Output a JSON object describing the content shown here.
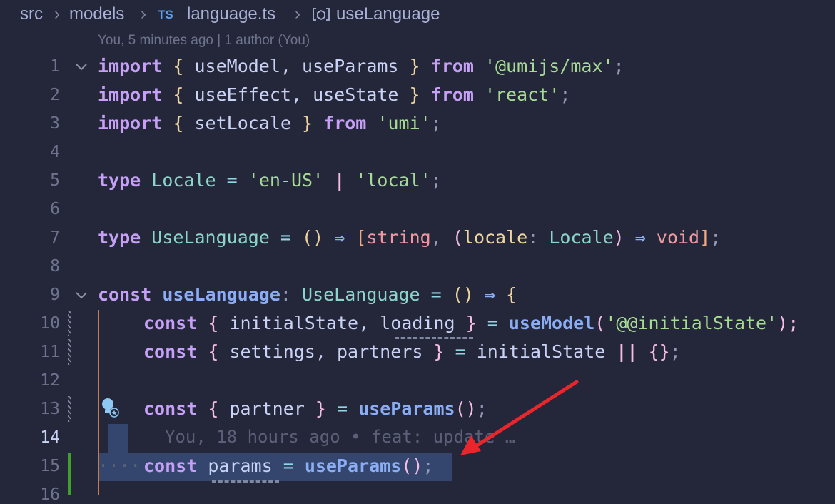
{
  "breadcrumb": {
    "items": [
      "src",
      "models",
      "language.ts",
      "useLanguage"
    ],
    "file_badge": "TS"
  },
  "blame_header": "You, 5 minutes ago | 1 author (You)",
  "inline_blame": "You, 18 hours ago • feat: update …",
  "line_numbers": [
    "1",
    "2",
    "3",
    "4",
    "5",
    "6",
    "7",
    "8",
    "9",
    "10",
    "11",
    "12",
    "13",
    "14",
    "15",
    "16"
  ],
  "active_line": "14",
  "code": {
    "l1": [
      "import",
      "{",
      "useModel, useParams",
      "}",
      "from",
      "'@umijs/max'",
      ";"
    ],
    "l2": [
      "import",
      "{",
      "useEffect, useState",
      "}",
      "from",
      "'react'",
      ";"
    ],
    "l3": [
      "import",
      "{",
      "setLocale",
      "}",
      "from",
      "'umi'",
      ";"
    ],
    "l5": [
      "type",
      "Locale",
      "=",
      "'en-US'",
      "|",
      "'local'",
      ";"
    ],
    "l7": [
      "type",
      "UseLanguage",
      "=",
      "(",
      ")",
      "⇒",
      "[",
      "string",
      ", ",
      "(",
      "locale",
      ":",
      "Locale",
      ")",
      "⇒",
      "void",
      "]",
      ";"
    ],
    "l9": [
      "const",
      "useLanguage",
      ":",
      "UseLanguage",
      "=",
      "(",
      ")",
      "⇒",
      "{"
    ],
    "l10": [
      "const",
      "{",
      "initialState, ",
      "loading",
      "}",
      "=",
      "useModel",
      "(",
      "'@@initialState'",
      ");"
    ],
    "l11": [
      "const",
      "{",
      "settings, partners",
      "}",
      "=",
      "initialState",
      "||",
      "{}",
      ";"
    ],
    "l13": [
      "const",
      "{",
      "partner",
      "}",
      "=",
      "useParams",
      "()",
      ";"
    ],
    "l15": [
      "const",
      "params",
      "=",
      "useParams",
      "()",
      ";"
    ]
  },
  "icons": [
    "chevron-right-icon",
    "typescript-file-icon",
    "symbol-method-icon",
    "fold-chevron-down-icon",
    "lightbulb-icon"
  ],
  "colors": {
    "background": "#24273a",
    "keyword": "#c6a0f6",
    "string": "#a6da95",
    "type": "#8bd5ca",
    "function": "#8aadf4",
    "selection": "#34466e",
    "added_line": "#40a02b",
    "annotation_arrow": "#e8262b"
  }
}
